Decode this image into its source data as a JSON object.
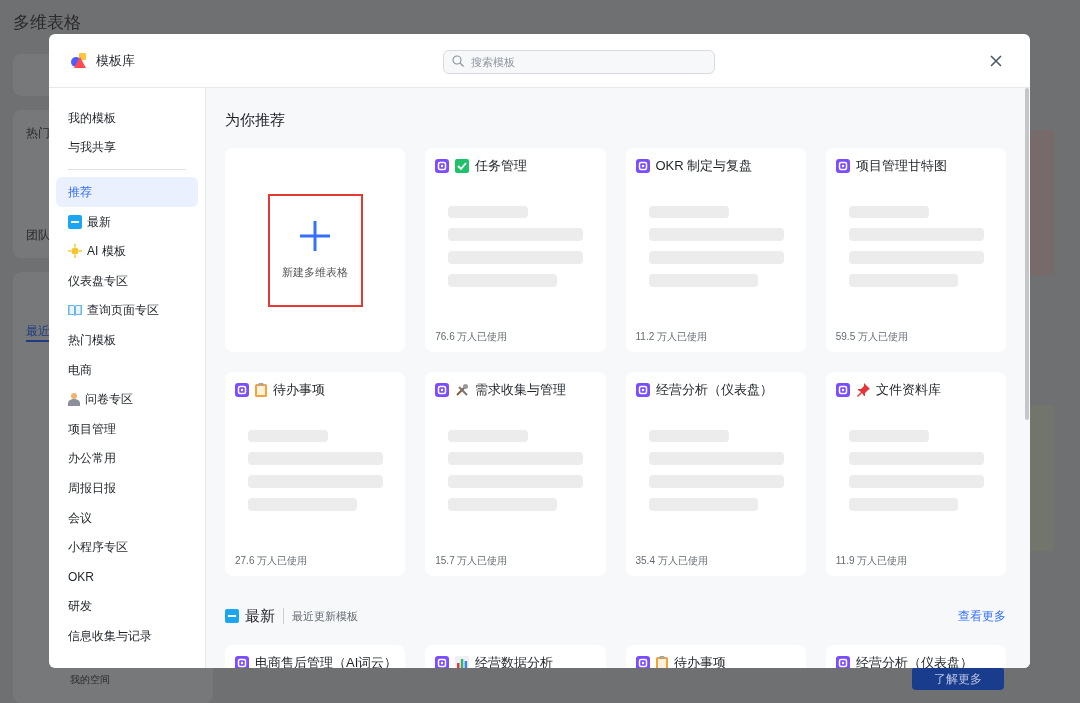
{
  "background": {
    "title": "多维表格",
    "labels": [
      "热门",
      "团队",
      "最近"
    ],
    "footer_link": "我的空间",
    "learn_more": "了解更多"
  },
  "modal": {
    "title": "模板库",
    "search": {
      "placeholder": "搜索模板"
    }
  },
  "sidebar": {
    "items": [
      {
        "kind": "plain",
        "label": "我的模板",
        "selected": false
      },
      {
        "kind": "plain",
        "label": "与我共享",
        "selected": false
      },
      {
        "kind": "divider"
      },
      {
        "kind": "plain",
        "label": "推荐",
        "selected": true
      },
      {
        "kind": "new",
        "label": "最新",
        "selected": false
      },
      {
        "kind": "sun",
        "label": "AI 模板",
        "selected": false
      },
      {
        "kind": "plain",
        "label": "仪表盘专区",
        "selected": false
      },
      {
        "kind": "book",
        "label": "查询页面专区",
        "selected": false
      },
      {
        "kind": "plain",
        "label": "热门模板",
        "selected": false
      },
      {
        "kind": "plain",
        "label": "电商",
        "selected": false
      },
      {
        "kind": "person",
        "label": "问卷专区",
        "selected": false
      },
      {
        "kind": "plain",
        "label": "项目管理",
        "selected": false
      },
      {
        "kind": "plain",
        "label": "办公常用",
        "selected": false
      },
      {
        "kind": "plain",
        "label": "周报日报",
        "selected": false
      },
      {
        "kind": "plain",
        "label": "会议",
        "selected": false
      },
      {
        "kind": "plain",
        "label": "小程序专区",
        "selected": false
      },
      {
        "kind": "plain",
        "label": "OKR",
        "selected": false
      },
      {
        "kind": "plain",
        "label": "研发",
        "selected": false
      },
      {
        "kind": "plain",
        "label": "信息收集与记录",
        "selected": false
      }
    ]
  },
  "sections": [
    {
      "kind": "plain",
      "title": "为你推荐",
      "cards": [
        {
          "kind": "create",
          "label": "新建多维表格",
          "highlighted": true
        },
        {
          "kind": "check",
          "title": "任务管理",
          "usage": "76.6 万人已使用"
        },
        {
          "kind": "plain",
          "title": "OKR 制定与复盘",
          "usage": "11.2 万人已使用"
        },
        {
          "kind": "plain",
          "title": "项目管理甘特图",
          "usage": "59.5 万人已使用"
        },
        {
          "kind": "clipboard",
          "title": "待办事项",
          "usage": "27.6 万人已使用"
        },
        {
          "kind": "tools",
          "title": "需求收集与管理",
          "usage": "15.7 万人已使用"
        },
        {
          "kind": "plain",
          "title": "经营分析（仪表盘）",
          "usage": "35.4 万人已使用"
        },
        {
          "kind": "pin",
          "title": "文件资料库",
          "usage": "11.9 万人已使用"
        }
      ]
    },
    {
      "kind": "new",
      "title": "最新",
      "subtitle": "最近更新模板",
      "more": "查看更多",
      "cards": [
        {
          "kind": "plain",
          "title": "电商售后管理（AI词云）"
        },
        {
          "kind": "chart",
          "title": "经营数据分析"
        },
        {
          "kind": "clipboard",
          "title": "待办事项"
        },
        {
          "kind": "plain",
          "title": "经营分析（仪表盘）"
        }
      ]
    }
  ]
}
